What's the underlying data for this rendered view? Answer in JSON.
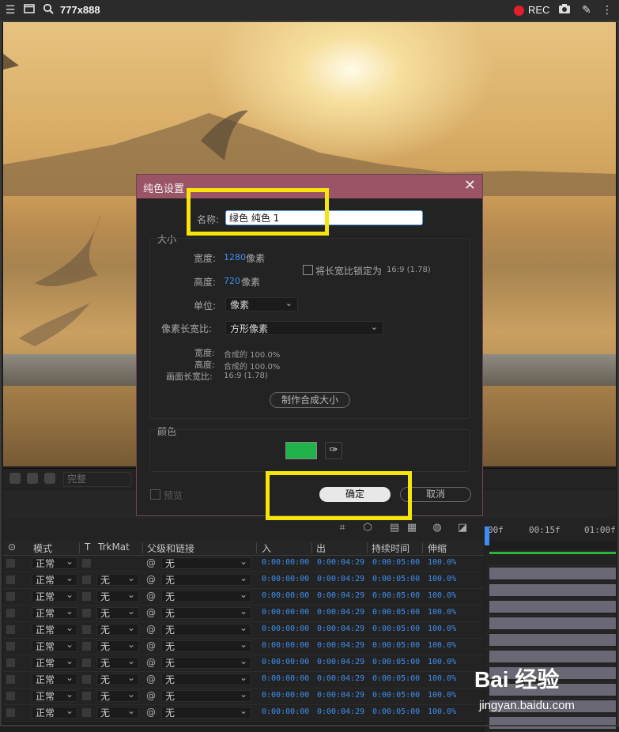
{
  "capture": {
    "size_label": "777x888",
    "rec_label": "REC"
  },
  "viewer": {
    "quality_label": "完整"
  },
  "timeline": {
    "ruler": [
      "00f",
      "00:15f",
      "01:00f"
    ],
    "columns": {
      "mode": "模式",
      "t": "T",
      "trkmat": "TrkMat",
      "parent": "父级和链接",
      "in": "入",
      "out": "出",
      "duration": "持续时间",
      "stretch": "伸缩"
    },
    "rows": [
      {
        "mode": "正常",
        "trk": "",
        "parent": "无",
        "in": "0:00:00:00",
        "out": "0:00:04:29",
        "dur": "0:00:05:00",
        "stretch": "100.0%"
      },
      {
        "mode": "正常",
        "trk": "无",
        "parent": "无",
        "in": "0:00:00:00",
        "out": "0:00:04:29",
        "dur": "0:00:05:00",
        "stretch": "100.0%"
      },
      {
        "mode": "正常",
        "trk": "无",
        "parent": "无",
        "in": "0:00:00:00",
        "out": "0:00:04:29",
        "dur": "0:00:05:00",
        "stretch": "100.0%"
      },
      {
        "mode": "正常",
        "trk": "无",
        "parent": "无",
        "in": "0:00:00:00",
        "out": "0:00:04:29",
        "dur": "0:00:05:00",
        "stretch": "100.0%"
      },
      {
        "mode": "正常",
        "trk": "无",
        "parent": "无",
        "in": "0:00:00:00",
        "out": "0:00:04:29",
        "dur": "0:00:05:00",
        "stretch": "100.0%"
      },
      {
        "mode": "正常",
        "trk": "无",
        "parent": "无",
        "in": "0:00:00:00",
        "out": "0:00:04:29",
        "dur": "0:00:05:00",
        "stretch": "100.0%"
      },
      {
        "mode": "正常",
        "trk": "无",
        "parent": "无",
        "in": "0:00:00:00",
        "out": "0:00:04:29",
        "dur": "0:00:05:00",
        "stretch": "100.0%"
      },
      {
        "mode": "正常",
        "trk": "无",
        "parent": "无",
        "in": "0:00:00:00",
        "out": "0:00:04:29",
        "dur": "0:00:05:00",
        "stretch": "100.0%"
      },
      {
        "mode": "正常",
        "trk": "无",
        "parent": "无",
        "in": "0:00:00:00",
        "out": "0:00:04:29",
        "dur": "0:00:05:00",
        "stretch": "100.0%"
      },
      {
        "mode": "正常",
        "trk": "无",
        "parent": "无",
        "in": "0:00:00:00",
        "out": "0:00:04:29",
        "dur": "0:00:05:00",
        "stretch": "100.0%"
      }
    ]
  },
  "dialog": {
    "title": "纯色设置",
    "name_label": "名称:",
    "name_value": "绿色 纯色 1",
    "size_group": "大小",
    "width_label": "宽度:",
    "width_value": "1280",
    "width_unit": "像素",
    "height_label": "高度:",
    "height_value": "720",
    "height_unit": "像素",
    "lock_label": "将长宽比锁定为",
    "lock_ratio": "16:9 (1.78)",
    "units_label": "单位:",
    "units_value": "像素",
    "pixel_aspect_label": "像素长宽比:",
    "pixel_aspect_value": "方形像素",
    "info_width_label": "宽度:",
    "info_width_value": "合成的 100.0%",
    "info_height_label": "高度:",
    "info_height_value": "合成的 100.0%",
    "frame_aspect_label": "画面长宽比:",
    "frame_aspect_value": "16:9 (1.78)",
    "make_comp_size": "制作合成大小",
    "color_group": "颜色",
    "color_value": "#22b24a",
    "preview_label": "预览",
    "ok_label": "确定",
    "cancel_label": "取消"
  },
  "watermark": {
    "brand": "Bai 经验",
    "url": "jingyan.baidu.com"
  }
}
